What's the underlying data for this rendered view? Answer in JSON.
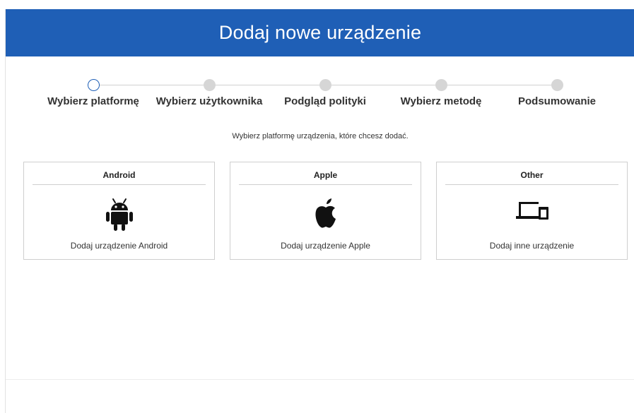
{
  "header": {
    "title": "Dodaj nowe urządzenie"
  },
  "steps": [
    {
      "label": "Wybierz platformę",
      "active": true
    },
    {
      "label": "Wybierz użytkownika",
      "active": false
    },
    {
      "label": "Podgląd polityki",
      "active": false
    },
    {
      "label": "Wybierz metodę",
      "active": false
    },
    {
      "label": "Podsumowanie",
      "active": false
    }
  ],
  "instruction": "Wybierz platformę urządzenia, które chcesz dodać.",
  "platforms": [
    {
      "title": "Android",
      "icon": "android-icon",
      "description": "Dodaj urządzenie Android"
    },
    {
      "title": "Apple",
      "icon": "apple-icon",
      "description": "Dodaj urządzenie Apple"
    },
    {
      "title": "Other",
      "icon": "devices-icon",
      "description": "Dodaj inne urządzenie"
    }
  ],
  "colors": {
    "header_bg": "#1f5fb6",
    "active_step": "#1f5fb6",
    "inactive_step": "#d6d6d6"
  }
}
